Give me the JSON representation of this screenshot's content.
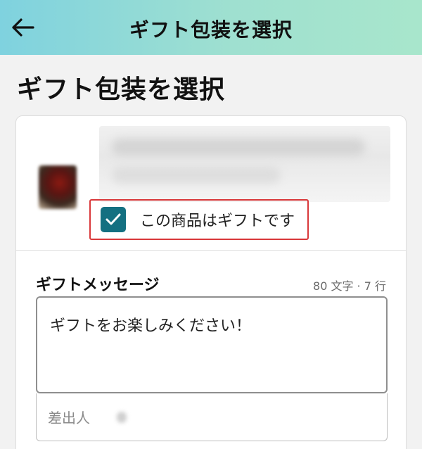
{
  "appbar": {
    "title": "ギフト包装を選択",
    "back_icon": "arrow-left-icon",
    "gradient_colors": [
      "#7fd2df",
      "#a8e6cc"
    ]
  },
  "page": {
    "title": "ギフト包装を選択"
  },
  "gift_option": {
    "label": "この商品はギフトです",
    "checked": true,
    "checkbox_color": "#147081",
    "highlight_color": "#d9383a"
  },
  "message": {
    "label": "ギフトメッセージ",
    "limit": "80 文字 · 7 行",
    "value": "ギフトをお楽しみください！"
  },
  "sender": {
    "label": "差出人"
  }
}
